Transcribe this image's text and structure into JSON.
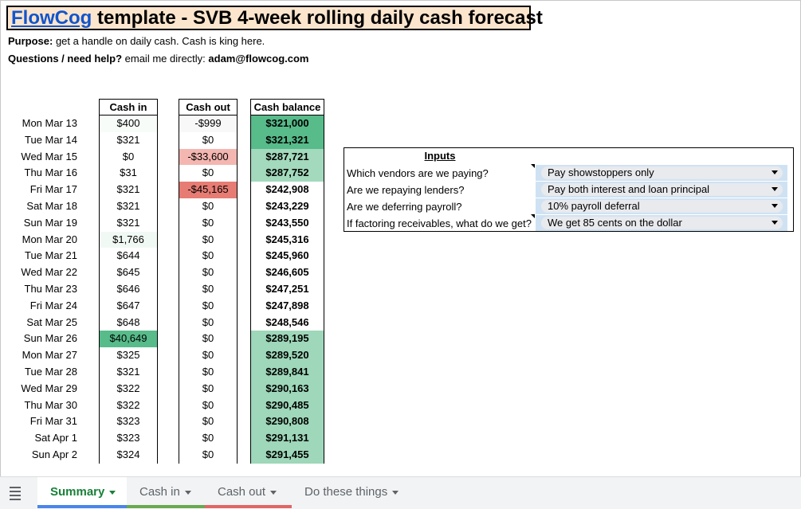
{
  "title": {
    "link": "FlowCog",
    "rest": " template - SVB 4-week rolling daily cash forecast"
  },
  "purpose": {
    "label": "Purpose:",
    "text": " get a handle on daily cash. Cash is king here."
  },
  "help": {
    "label": "Questions / need help?",
    "text": " email me directly: ",
    "email": "adam@flowcog.com"
  },
  "headers": {
    "cash_in": "Cash in",
    "cash_out": "Cash out",
    "balance": "Cash balance"
  },
  "rows": [
    {
      "date": "Mon Mar 13",
      "in": "$400",
      "out": "-$999",
      "bal": "$321,000"
    },
    {
      "date": "Tue Mar 14",
      "in": "$321",
      "out": "$0",
      "bal": "$321,321"
    },
    {
      "date": "Wed Mar 15",
      "in": "$0",
      "out": "-$33,600",
      "bal": "$287,721"
    },
    {
      "date": "Thu Mar 16",
      "in": "$31",
      "out": "$0",
      "bal": "$287,752"
    },
    {
      "date": "Fri Mar 17",
      "in": "$321",
      "out": "-$45,165",
      "bal": "$242,908"
    },
    {
      "date": "Sat Mar 18",
      "in": "$321",
      "out": "$0",
      "bal": "$243,229"
    },
    {
      "date": "Sun Mar 19",
      "in": "$321",
      "out": "$0",
      "bal": "$243,550"
    },
    {
      "date": "Mon Mar 20",
      "in": "$1,766",
      "out": "$0",
      "bal": "$245,316"
    },
    {
      "date": "Tue Mar 21",
      "in": "$644",
      "out": "$0",
      "bal": "$245,960"
    },
    {
      "date": "Wed Mar 22",
      "in": "$645",
      "out": "$0",
      "bal": "$246,605"
    },
    {
      "date": "Thu Mar 23",
      "in": "$646",
      "out": "$0",
      "bal": "$247,251"
    },
    {
      "date": "Fri Mar 24",
      "in": "$647",
      "out": "$0",
      "bal": "$247,898"
    },
    {
      "date": "Sat Mar 25",
      "in": "$648",
      "out": "$0",
      "bal": "$248,546"
    },
    {
      "date": "Sun Mar 26",
      "in": "$40,649",
      "out": "$0",
      "bal": "$289,195"
    },
    {
      "date": "Mon Mar 27",
      "in": "$325",
      "out": "$0",
      "bal": "$289,520"
    },
    {
      "date": "Tue Mar 28",
      "in": "$321",
      "out": "$0",
      "bal": "$289,841"
    },
    {
      "date": "Wed Mar 29",
      "in": "$322",
      "out": "$0",
      "bal": "$290,163"
    },
    {
      "date": "Thu Mar 30",
      "in": "$322",
      "out": "$0",
      "bal": "$290,485"
    },
    {
      "date": "Fri Mar 31",
      "in": "$323",
      "out": "$0",
      "bal": "$290,808"
    },
    {
      "date": "Sat Apr 1",
      "in": "$323",
      "out": "$0",
      "bal": "$291,131"
    },
    {
      "date": "Sun Apr 2",
      "in": "$324",
      "out": "$0",
      "bal": "$291,455"
    }
  ],
  "inputs": {
    "title": "Inputs",
    "items": [
      {
        "question": "Which vendors are we paying?",
        "value": "Pay showstoppers only"
      },
      {
        "question": "Are we repaying lenders?",
        "value": "Pay both interest and loan principal"
      },
      {
        "question": "Are we deferring payroll?",
        "value": "10% payroll deferral"
      },
      {
        "question": "If factoring receivables, what do we get?",
        "value": "We get 85 cents on the dollar"
      }
    ]
  },
  "tabs": [
    {
      "label": "Summary",
      "accent": "#4a86e8",
      "active": true
    },
    {
      "label": "Cash in",
      "accent": "#6aa84f",
      "active": false
    },
    {
      "label": "Cash out",
      "accent": "#e06666",
      "active": false
    },
    {
      "label": "Do these things",
      "accent": "",
      "active": false
    }
  ],
  "colors": {
    "title_bg": "#fce5cd",
    "green_dark": "#57bb8a",
    "green_light": "#b7e1cd",
    "red": "#e67c73",
    "red_light": "#f4b6b0"
  }
}
